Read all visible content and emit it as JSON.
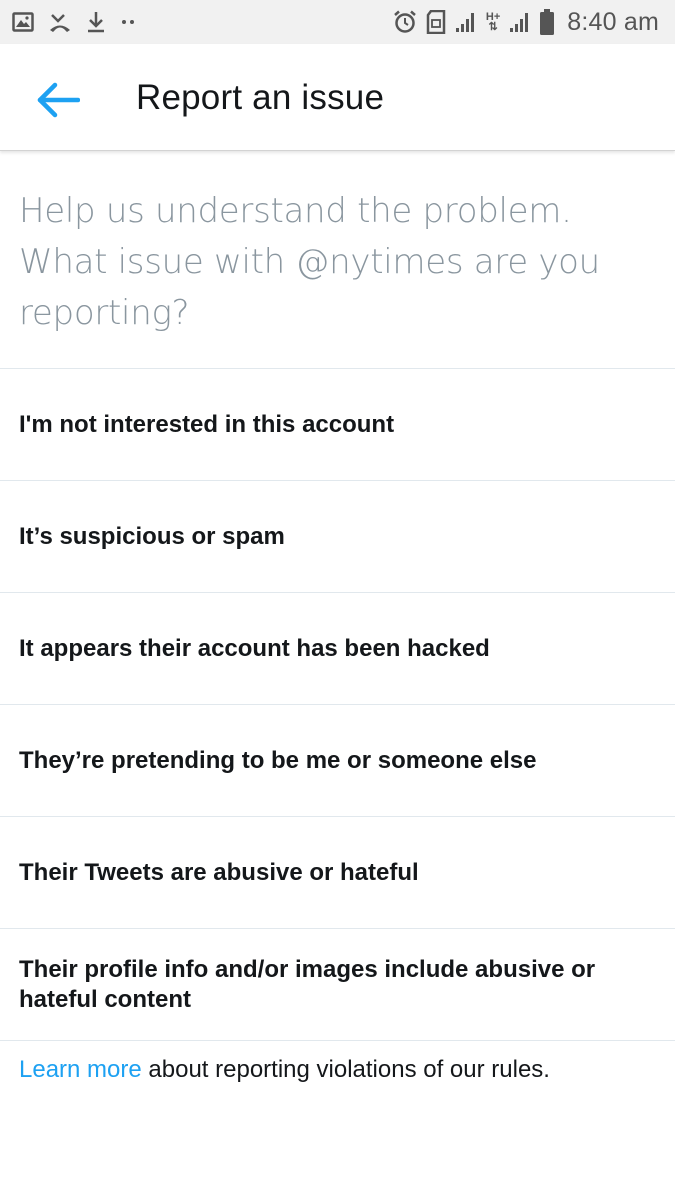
{
  "status_bar": {
    "time": "8:40 am",
    "left_icons": [
      "image-icon",
      "missed-call-icon",
      "download-icon",
      "more-dots-icon"
    ],
    "right_icons": [
      "alarm-icon",
      "sd-card-icon",
      "signal-icon",
      "hplus-icon",
      "signal-icon",
      "battery-icon"
    ],
    "network_label": "H+"
  },
  "header": {
    "back_icon": "back-arrow-icon",
    "title": "Report an issue",
    "accent_color": "#1da1f2"
  },
  "prompt": "Help us understand the problem. What issue with @nytimes are you reporting?",
  "options": [
    {
      "label": "I'm not interested in this account"
    },
    {
      "label": "It’s suspicious or spam"
    },
    {
      "label": "It appears their account has been hacked"
    },
    {
      "label": "They’re pretending to be me or someone else"
    },
    {
      "label": "Their Tweets are abusive or hateful"
    },
    {
      "label": "Their profile info and/or images include abusive or hateful content"
    }
  ],
  "footer": {
    "link_text": "Learn more",
    "text": " about reporting violations of our rules."
  }
}
